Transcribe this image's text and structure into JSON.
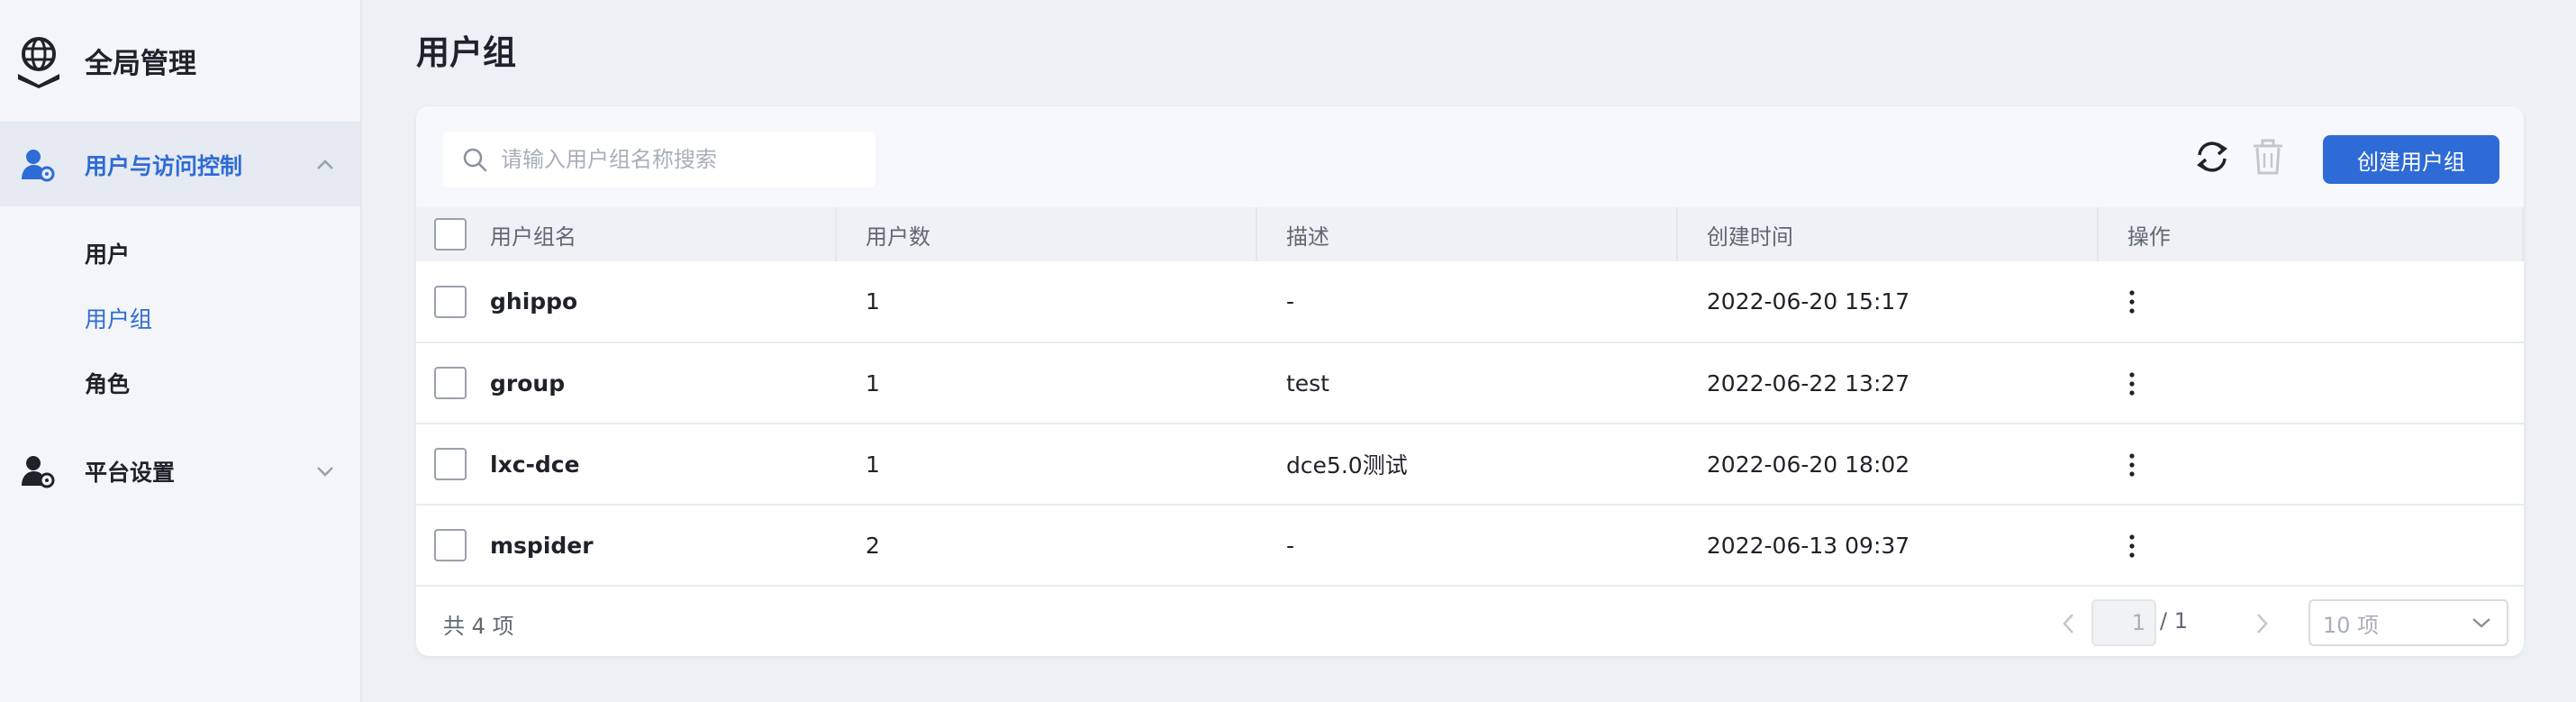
{
  "app": {
    "title": "全局管理"
  },
  "sidebar": {
    "groups": [
      {
        "label": "用户与访问控制",
        "expanded": true,
        "items": [
          {
            "label": "用户",
            "active": false
          },
          {
            "label": "用户组",
            "active": true
          },
          {
            "label": "角色",
            "active": false
          }
        ]
      },
      {
        "label": "平台设置",
        "expanded": false
      }
    ]
  },
  "page": {
    "title": "用户组"
  },
  "toolbar": {
    "search_placeholder": "请输入用户组名称搜索",
    "create_label": "创建用户组",
    "refresh_icon": "refresh-icon",
    "delete_icon": "trash-icon"
  },
  "table": {
    "columns": [
      "用户组名",
      "用户数",
      "描述",
      "创建时间",
      "操作"
    ],
    "rows": [
      {
        "name": "ghippo",
        "count": "1",
        "desc": "-",
        "created": "2022-06-20 15:17"
      },
      {
        "name": "group",
        "count": "1",
        "desc": "test",
        "created": "2022-06-22 13:27"
      },
      {
        "name": "lxc-dce",
        "count": "1",
        "desc": "dce5.0测试",
        "created": "2022-06-20 18:02"
      },
      {
        "name": "mspider",
        "count": "2",
        "desc": "-",
        "created": "2022-06-13 09:37"
      }
    ]
  },
  "pagination": {
    "total_text": "共 4 项",
    "current_page": "1",
    "page_total": "/ 1",
    "page_size": "10 项"
  },
  "colors": {
    "accent": "#2e6bd6",
    "sidebar_bg": "#f3f5f9",
    "page_bg": "#edf0f4"
  }
}
